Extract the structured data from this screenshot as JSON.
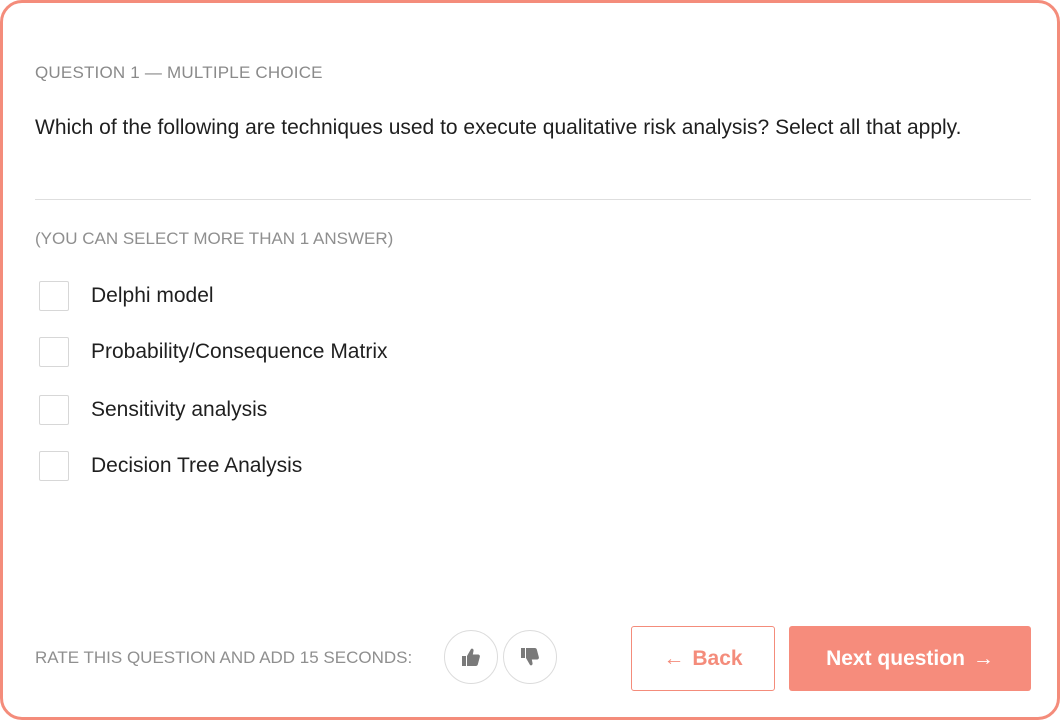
{
  "question": {
    "label": "QUESTION 1 — MULTIPLE CHOICE",
    "text": "Which of the following are techniques used to execute qualitative risk analysis? Select all that apply.",
    "hint": "(YOU CAN SELECT MORE THAN 1 ANSWER)"
  },
  "options": [
    {
      "label": "Delphi model",
      "checked": false
    },
    {
      "label": "Probability/Consequence Matrix",
      "checked": false
    },
    {
      "label": "Sensitivity analysis",
      "checked": false
    },
    {
      "label": "Decision Tree Analysis",
      "checked": false
    }
  ],
  "rating": {
    "label": "RATE THIS QUESTION AND ADD 15 SECONDS:",
    "thumbs_up_icon": "thumbs-up-icon",
    "thumbs_down_icon": "thumbs-down-icon"
  },
  "nav": {
    "back_arrow": "←",
    "back_label": "Back",
    "next_label": "Next question",
    "next_arrow": "→"
  },
  "colors": {
    "accent": "#f48c7b",
    "muted_text": "#8f8f8f"
  }
}
